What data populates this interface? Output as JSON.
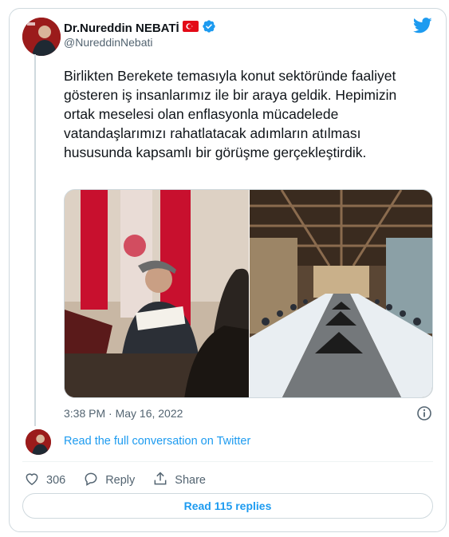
{
  "author": {
    "name": "Dr.Nureddin NEBATİ",
    "handle": "@NureddinNebati",
    "flag_icon": "turkey-flag-icon",
    "verified_icon": "verified-badge-icon"
  },
  "tweet": {
    "text": "Birlikten Berekete temasıyla konut sektöründe faaliyet gösteren iş insanlarımız ile bir araya geldik. Hepimizin ortak meselesi olan enflasyonla mücadelede vatandaşlarımızı rahatlatacak adımların atılması hususunda kapsamlı bir görüşme gerçekleştirdik.",
    "timestamp": "3:38 PM · May 16, 2022"
  },
  "conversation": {
    "link_label": "Read the full conversation on Twitter"
  },
  "actions": {
    "likes_count": "306",
    "reply_label": "Reply",
    "share_label": "Share"
  },
  "replies": {
    "button_label": "Read 115 replies"
  },
  "colors": {
    "accent": "#1d9bf0",
    "border": "#cfd9de",
    "secondary_text": "#536471",
    "flag_red": "#e30a17"
  }
}
